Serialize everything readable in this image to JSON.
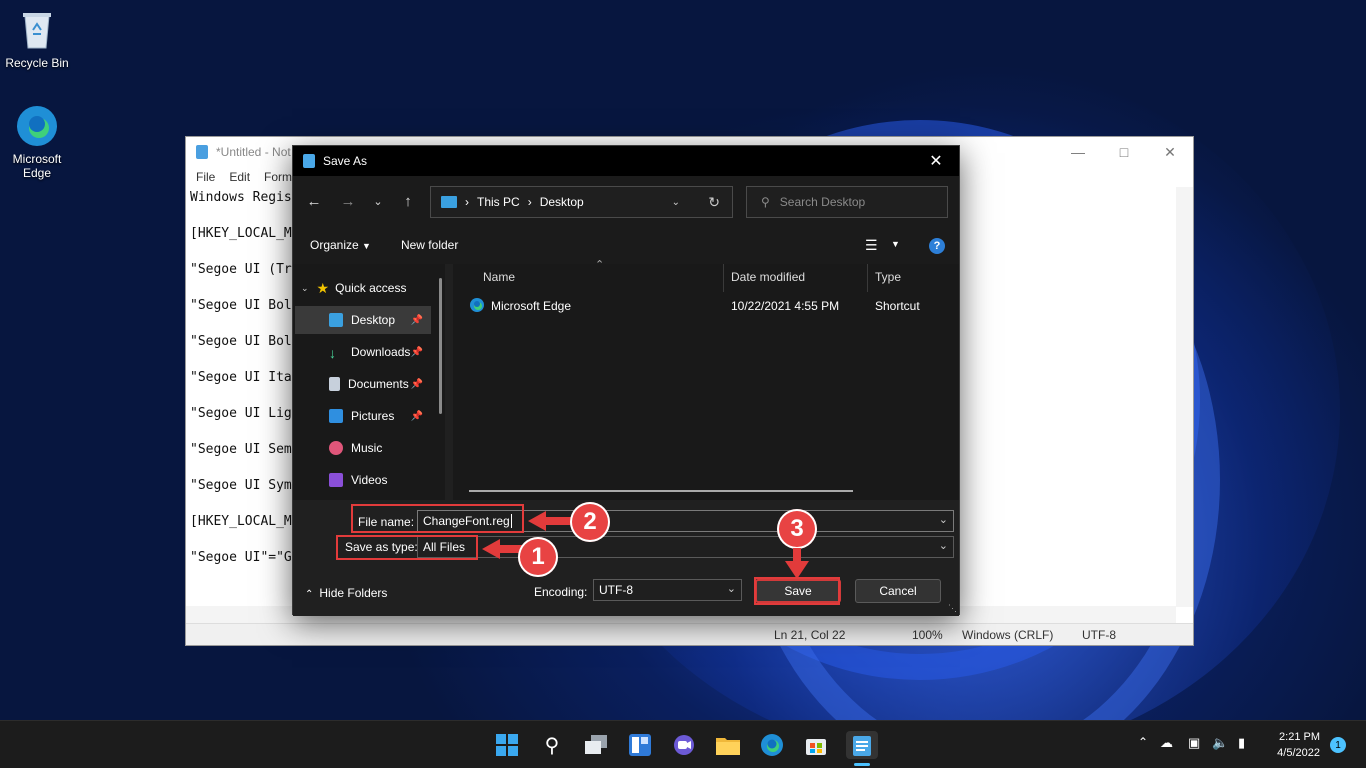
{
  "desktop": {
    "icons": [
      {
        "label": "Recycle Bin"
      },
      {
        "label": "Microsoft Edge"
      }
    ]
  },
  "notepad": {
    "title": "*Untitled - Not",
    "menu": [
      "File",
      "Edit",
      "Forma"
    ],
    "lines": [
      "Windows Regis",
      "[HKEY_LOCAL_M",
      "\"Segoe UI (Tr",
      "\"Segoe UI Bol",
      "\"Segoe UI Bol",
      "\"Segoe UI Ita",
      "\"Segoe UI Lig",
      "\"Segoe UI Sem",
      "\"Segoe UI Sym",
      "[HKEY_LOCAL_M",
      "\"Segoe UI\"=\"G"
    ],
    "status": {
      "position": "Ln 21, Col 22",
      "zoom": "100%",
      "line_endings": "Windows (CRLF)",
      "encoding": "UTF-8"
    }
  },
  "dialog": {
    "title": "Save As",
    "address": {
      "segments": [
        "This PC",
        "Desktop"
      ]
    },
    "search_placeholder": "Search Desktop",
    "commands": {
      "organize": "Organize",
      "new_folder": "New folder"
    },
    "nav": {
      "quick_access": "Quick access",
      "items": [
        "Desktop",
        "Downloads",
        "Documents",
        "Pictures",
        "Music",
        "Videos"
      ]
    },
    "columns": {
      "name": "Name",
      "date": "Date modified",
      "type": "Type"
    },
    "files": [
      {
        "name": "Microsoft Edge",
        "date": "10/22/2021 4:55 PM",
        "type": "Shortcut"
      }
    ],
    "file_name_label": "File name:",
    "file_name_value": "ChangeFont.reg",
    "save_type_label": "Save as type:",
    "save_type_value": "All Files",
    "hide_folders": "Hide Folders",
    "encoding_label": "Encoding:",
    "encoding_value": "UTF-8",
    "save": "Save",
    "cancel": "Cancel"
  },
  "annotations": {
    "steps": [
      "1",
      "2",
      "3"
    ],
    "color": "#e23b3b"
  },
  "taskbar": {
    "time": "2:21 PM",
    "date": "4/5/2022",
    "notification_count": "1"
  }
}
